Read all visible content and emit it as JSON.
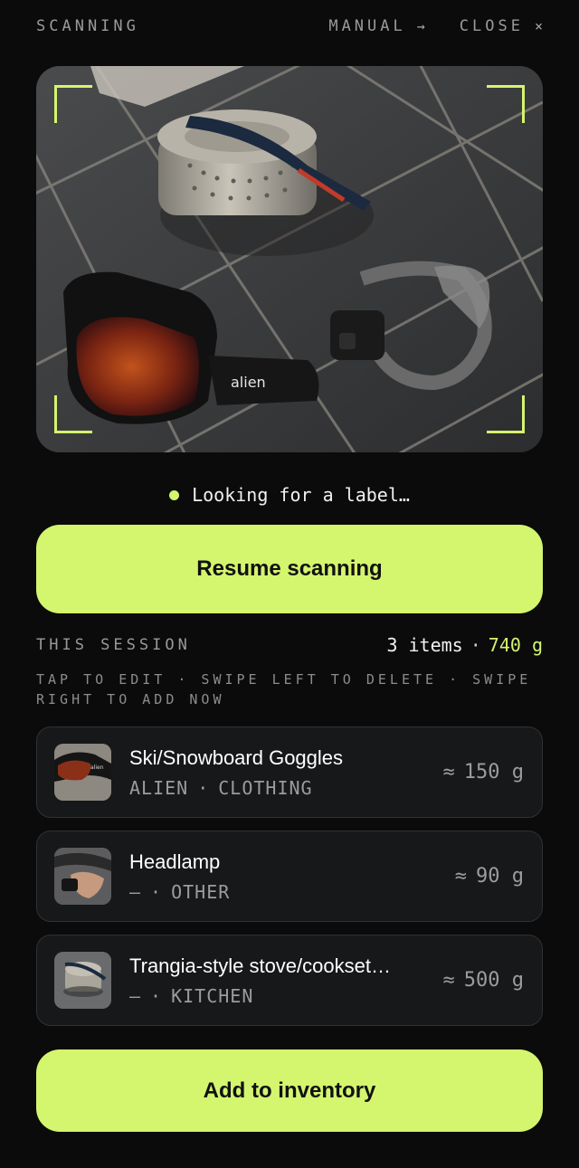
{
  "topbar": {
    "title": "SCANNING",
    "manual_label": "MANUAL",
    "manual_icon": "→",
    "close_label": "CLOSE",
    "close_icon": "×"
  },
  "status": {
    "text": "Looking for a label…"
  },
  "buttons": {
    "resume": "Resume scanning",
    "add": "Add to inventory"
  },
  "session": {
    "label": "THIS SESSION",
    "items_text": "3 items",
    "separator": "·",
    "total_weight": "740 g",
    "hint": "TAP TO EDIT · SWIPE LEFT TO DELETE · SWIPE RIGHT TO ADD NOW"
  },
  "items": [
    {
      "name": "Ski/Snowboard Goggles",
      "brand": "ALIEN",
      "sep": "·",
      "category": "CLOTHING",
      "approx": "≈",
      "weight": "150 g"
    },
    {
      "name": "Headlamp",
      "brand": "—",
      "sep": "·",
      "category": "OTHER",
      "approx": "≈",
      "weight": "90 g"
    },
    {
      "name": "Trangia-style stove/cookset…",
      "brand": "—",
      "sep": "·",
      "category": "KITCHEN",
      "approx": "≈",
      "weight": "500 g"
    }
  ],
  "colors": {
    "accent": "#d4f56e",
    "background": "#0b0b0b",
    "card": "#16181a"
  }
}
